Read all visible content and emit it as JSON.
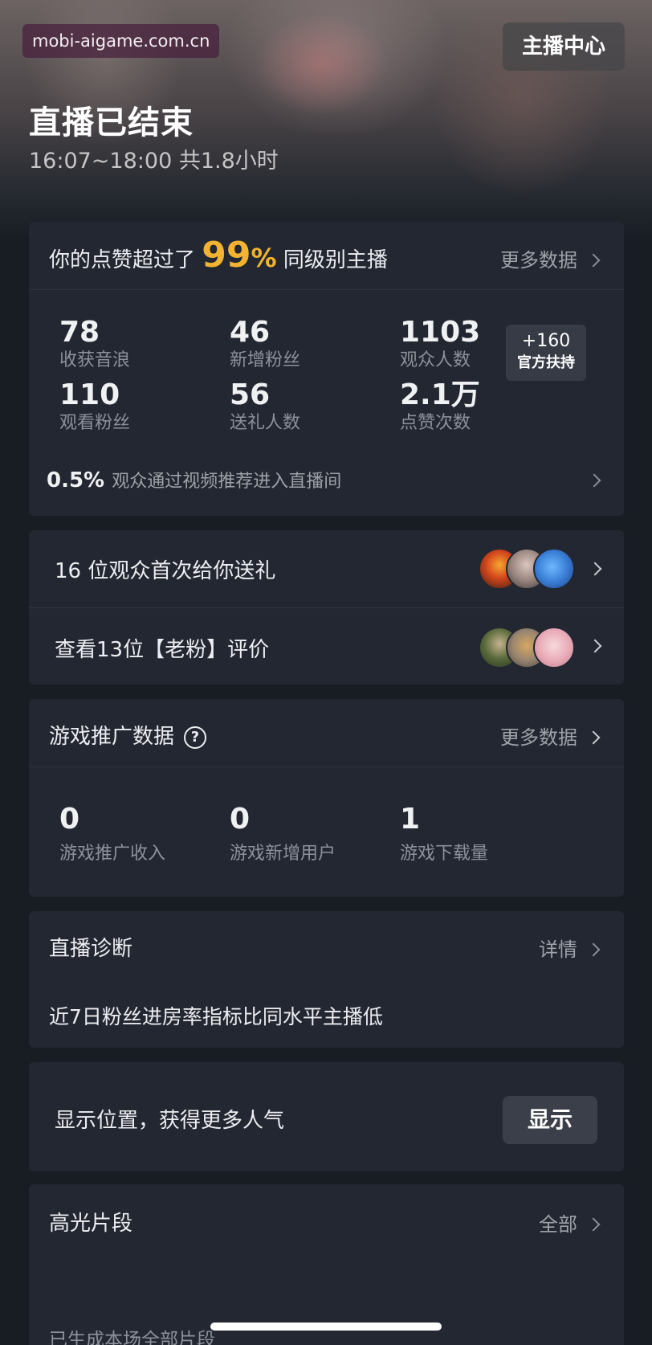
{
  "watermark": "mobi-aigame.com.cn",
  "header": {
    "host_center": "主播中心",
    "title": "直播已结束",
    "time_range": "16:07~18:00 共1.8小时"
  },
  "summary": {
    "like_prefix": "你的点赞超过了",
    "like_value": "99",
    "like_unit": "%",
    "like_suffix": "同级别主播",
    "more_label": "更多数据",
    "stats": [
      {
        "value": "78",
        "label": "收获音浪"
      },
      {
        "value": "46",
        "label": "新增粉丝"
      },
      {
        "value": "1103",
        "label": "观众人数"
      },
      {
        "value": "110",
        "label": "观看粉丝"
      },
      {
        "value": "56",
        "label": "送礼人数"
      },
      {
        "value": "2.1万",
        "label": "点赞次数"
      }
    ],
    "badge_value": "+160",
    "badge_label": "官方扶持",
    "video_rate": "0.5%",
    "video_rate_text": "观众通过视频推荐进入直播间"
  },
  "audience": {
    "first_gift": "16 位观众首次给你送礼",
    "old_fans": "查看13位【老粉】评价"
  },
  "game": {
    "title": "游戏推广数据",
    "help_icon": "?",
    "more_label": "更多数据",
    "stats": [
      {
        "value": "0",
        "label": "游戏推广收入"
      },
      {
        "value": "0",
        "label": "游戏新增用户"
      },
      {
        "value": "1",
        "label": "游戏下载量"
      }
    ]
  },
  "diagnosis": {
    "title": "直播诊断",
    "detail_label": "详情",
    "text": "近7日粉丝进房率指标比同水平主播低"
  },
  "location": {
    "text": "显示位置，获得更多人气",
    "button": "显示"
  },
  "highlights": {
    "title": "高光片段",
    "all_label": "全部",
    "subtext": "已生成本场全部片段"
  },
  "colors": {
    "accent": "#f2b232",
    "card_bg": "#222731",
    "page_bg": "#181c23"
  }
}
